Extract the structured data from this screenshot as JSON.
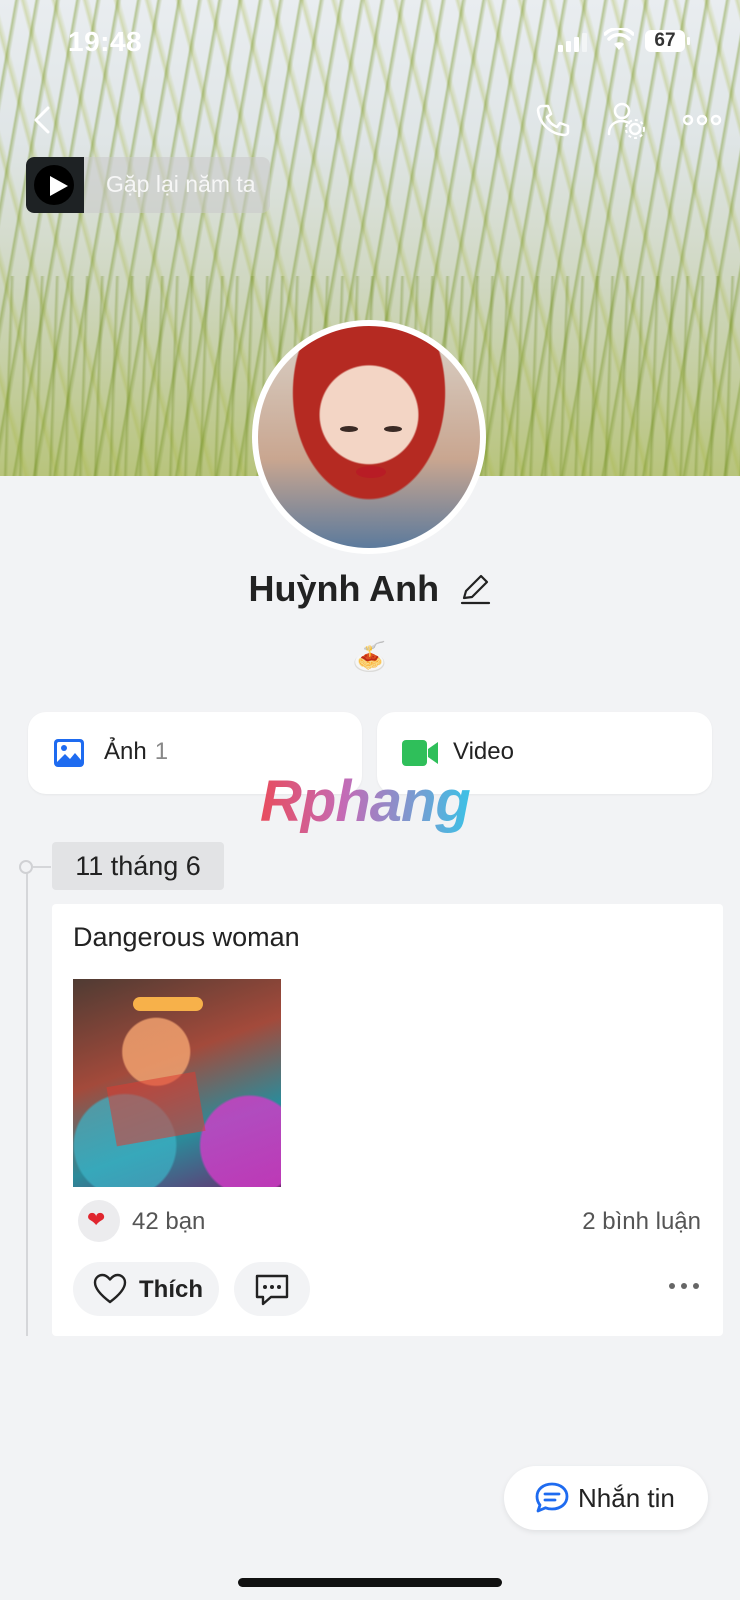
{
  "status_bar": {
    "time": "19:48",
    "battery": "67"
  },
  "music": {
    "title": "Gặp lại năm ta"
  },
  "profile": {
    "name": "Huỳnh Anh",
    "status_emoji": "🍝"
  },
  "media_tabs": {
    "photos": {
      "label": "Ảnh",
      "count": "1"
    },
    "videos": {
      "label": "Video"
    }
  },
  "watermark": "Rphang",
  "timeline": {
    "date": "11 tháng 6",
    "post": {
      "title": "Dangerous woman",
      "likes_text": "42 bạn",
      "comments_text": "2 bình luận",
      "like_label": "Thích"
    }
  },
  "message_button": {
    "label": "Nhắn tin"
  },
  "colors": {
    "photo_icon": "#1e6bf0",
    "video_icon": "#2fbf5a",
    "message_icon": "#1e6bf0",
    "heart": "#e0262f"
  }
}
